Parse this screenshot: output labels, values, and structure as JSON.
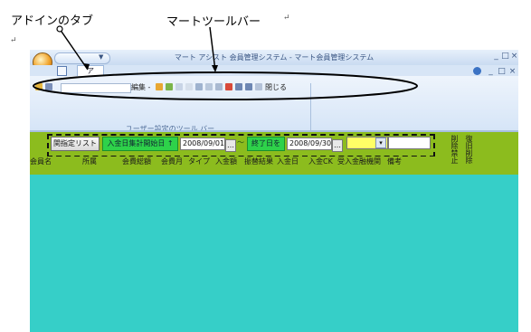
{
  "annotations": {
    "addin_tab": "アドインのタブ",
    "smart_toolbar": "マートツールバー",
    "return_mark": "↵"
  },
  "window": {
    "title": "マート アシスト 会員管理システム  -  マート会員管理システム",
    "qat_dropdown": "▼",
    "controls": [
      "_",
      "□",
      "×"
    ],
    "tab_addins": "ア",
    "help_controls": [
      "_",
      "□",
      "×"
    ]
  },
  "ribbon": {
    "combo_value": "",
    "items": [
      {
        "label": "編集 -",
        "icon": "edit-icon"
      },
      {
        "label": "",
        "icon": "pencil-icon"
      },
      {
        "label": "",
        "icon": "paint-icon"
      },
      {
        "label": "",
        "icon": "undo-icon"
      },
      {
        "label": "",
        "icon": "redo-icon"
      },
      {
        "label": "",
        "icon": "refresh-icon"
      },
      {
        "label": "",
        "icon": "filter-icon"
      },
      {
        "label": "",
        "icon": "sort-asc-icon"
      },
      {
        "label": "",
        "icon": "sort-desc-icon"
      },
      {
        "label": "閉じる",
        "icon": "close-doc-icon"
      }
    ],
    "group_label": "ユーザー設定のツール バー"
  },
  "filter_bar": {
    "designated_list_button": "関指定リスト",
    "from_label": "入金日集計開始日 ↑",
    "from_date": "2008/09/01",
    "to_label": "終了日を",
    "tilde": "〜",
    "to_date": "2008/09/30",
    "date_button": "…",
    "combo_arrow": "▾"
  },
  "columns": [
    "会員名",
    "所属",
    "会費総額",
    "会費月",
    "タイプ",
    "入金額",
    "振替結果",
    "入金日",
    "入金CK",
    "受入金融機関",
    "備考"
  ],
  "vertical_columns": [
    "削除禁止",
    "復旧削除"
  ],
  "colors": {
    "green_bar": "#8cbc1e",
    "data_area": "#36cfc8",
    "label_green": "#2ed24a",
    "ribbon_light": "#eef4fc"
  }
}
